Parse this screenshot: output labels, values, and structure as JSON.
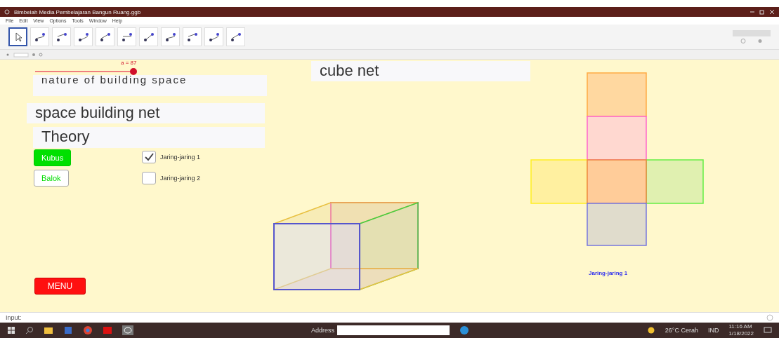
{
  "window": {
    "title": "Bimbelah Media Pembelajaran Bangun Ruang.ggb"
  },
  "menu": [
    "File",
    "Edit",
    "View",
    "Options",
    "Tools",
    "Window",
    "Help"
  ],
  "toolbar": {
    "tools": [
      {
        "selected": true
      },
      {
        "selected": false
      },
      {
        "selected": false
      },
      {
        "selected": false
      },
      {
        "selected": false
      },
      {
        "selected": false
      },
      {
        "selected": false
      },
      {
        "selected": false
      },
      {
        "selected": false
      },
      {
        "selected": false
      },
      {
        "selected": false
      }
    ]
  },
  "canvas": {
    "slider": {
      "label": "a = 87",
      "level": 1
    },
    "text_boxes": [
      {
        "text": "nature of building space",
        "kind": "small"
      },
      {
        "text": "space building net",
        "kind": "large"
      },
      {
        "text": "Theory",
        "kind": "large"
      },
      {
        "text": "cube net",
        "kind": "large"
      }
    ],
    "buttons": [
      {
        "label": "Kubus",
        "selected": true
      },
      {
        "label": "Balok",
        "selected": false
      }
    ],
    "checkboxes": [
      {
        "label": "Jaring-jaring 1",
        "checked": true
      },
      {
        "label": "Jaring-jaring 2",
        "checked": false
      }
    ],
    "menu_button": "MENU",
    "net_caption": "Jaring-jaring 1"
  },
  "input_bar": {
    "label": "Input:"
  },
  "taskbar": {
    "address_label": "Address",
    "weather": "26°C Cerah",
    "language": "IND",
    "time": "11:16 AM",
    "date": "1/18/2022"
  }
}
